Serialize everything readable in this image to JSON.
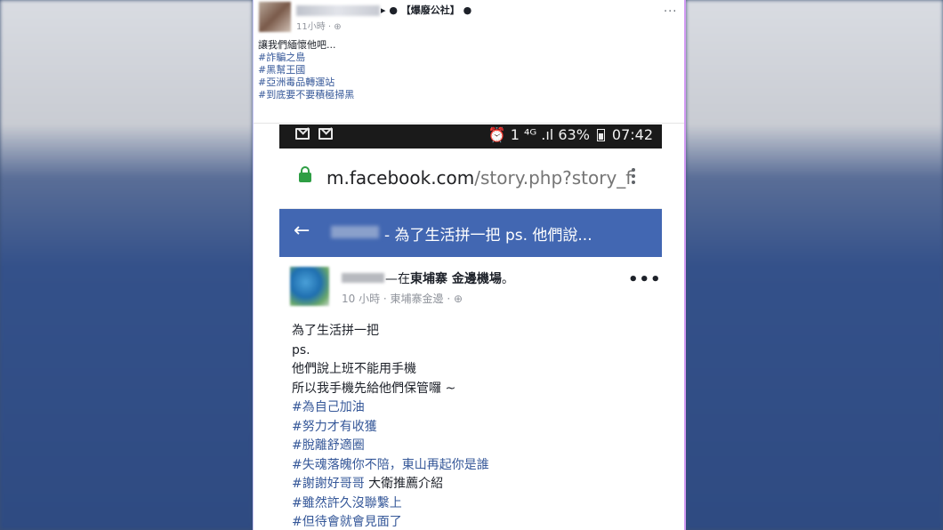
{
  "post": {
    "group_link": "▸ ● 【爆廢公社】 ●",
    "time": "11小時 · ⊕",
    "more": "···",
    "text_lines": [
      "讓我們緬懷他吧..."
    ],
    "hashtags": [
      "#詐騙之島",
      "#黑幫王國",
      "#亞洲毒品轉運站",
      "#到底要不要積極掃黑"
    ]
  },
  "phone": {
    "statusbar": {
      "right_text": "⏰ 1 ⁴ᴳ .ıl 63%",
      "time": "07:42"
    },
    "url": {
      "host": "m.facebook.com",
      "path": "/story.php?story_f"
    },
    "fb_header": {
      "title": "- 為了生活拼一把 ps. 他們說..."
    },
    "story": {
      "checkin_prefix": "—在",
      "checkin_place": "東埔寨 金邊機場",
      "checkin_suffix": "。",
      "meta": "10 小時 · 東埔寨金邊 · ⊕",
      "more": "•••",
      "lines": [
        "為了生活拼一把",
        "ps.",
        "他們說上班不能用手機",
        "所以我手機先給他們保管囉 ~"
      ],
      "hashtags": [
        "#為自己加油",
        "#努力才有收獲",
        "#脫離舒適圈",
        "#失魂落魄你不陪，東山再起你是誰"
      ],
      "mixed_line": {
        "tag": "#謝謝好哥哥",
        "text": " 大衛推薦介紹"
      },
      "hashtags_end": [
        "#雖然許久沒聯繫上",
        "#但待會就會見面了"
      ]
    }
  }
}
